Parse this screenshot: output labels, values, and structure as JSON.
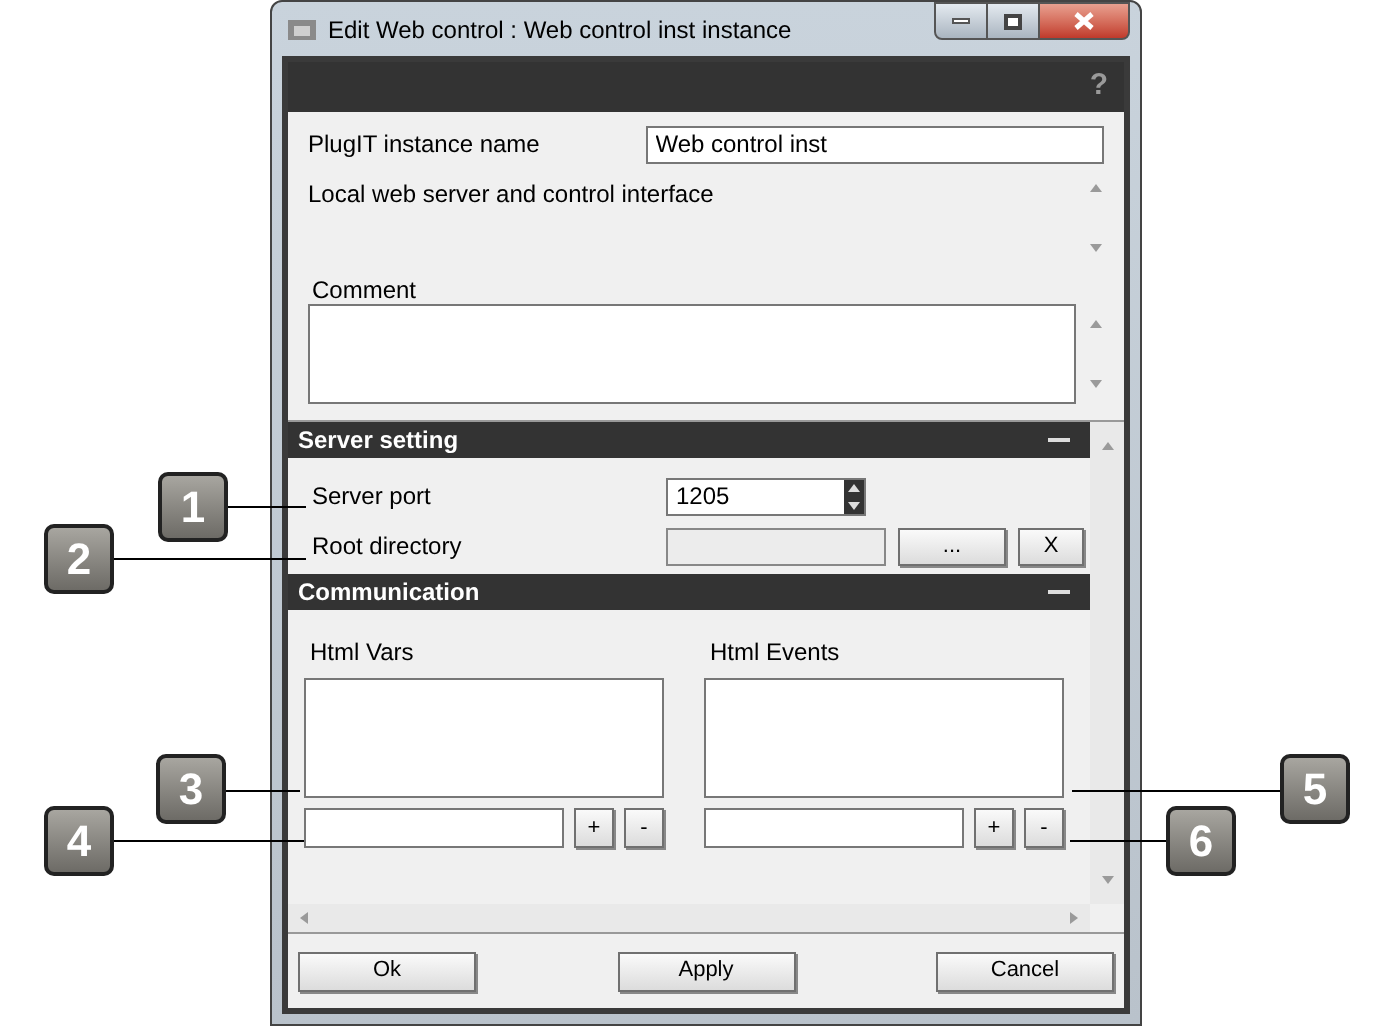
{
  "window": {
    "title": "Edit Web control : Web control inst instance",
    "help_glyph": "?"
  },
  "instance_name": {
    "label": "PlugIT instance name",
    "value": "Web control inst"
  },
  "description": "Local web server and control interface",
  "comment": {
    "label": "Comment"
  },
  "server_setting": {
    "title": "Server setting",
    "server_port": {
      "label": "Server port",
      "value": "1205"
    },
    "root_directory": {
      "label": "Root directory",
      "browse_button": "...",
      "clear_button": "X"
    }
  },
  "communication": {
    "title": "Communication",
    "lists": [
      {
        "label": "Html Vars",
        "add_button": "+",
        "remove_button": "-"
      },
      {
        "label": "Html Events",
        "add_button": "+",
        "remove_button": "-"
      }
    ]
  },
  "buttons": [
    "Ok",
    "Apply",
    "Cancel"
  ],
  "callouts": [
    "1",
    "2",
    "3",
    "4",
    "5",
    "6"
  ]
}
